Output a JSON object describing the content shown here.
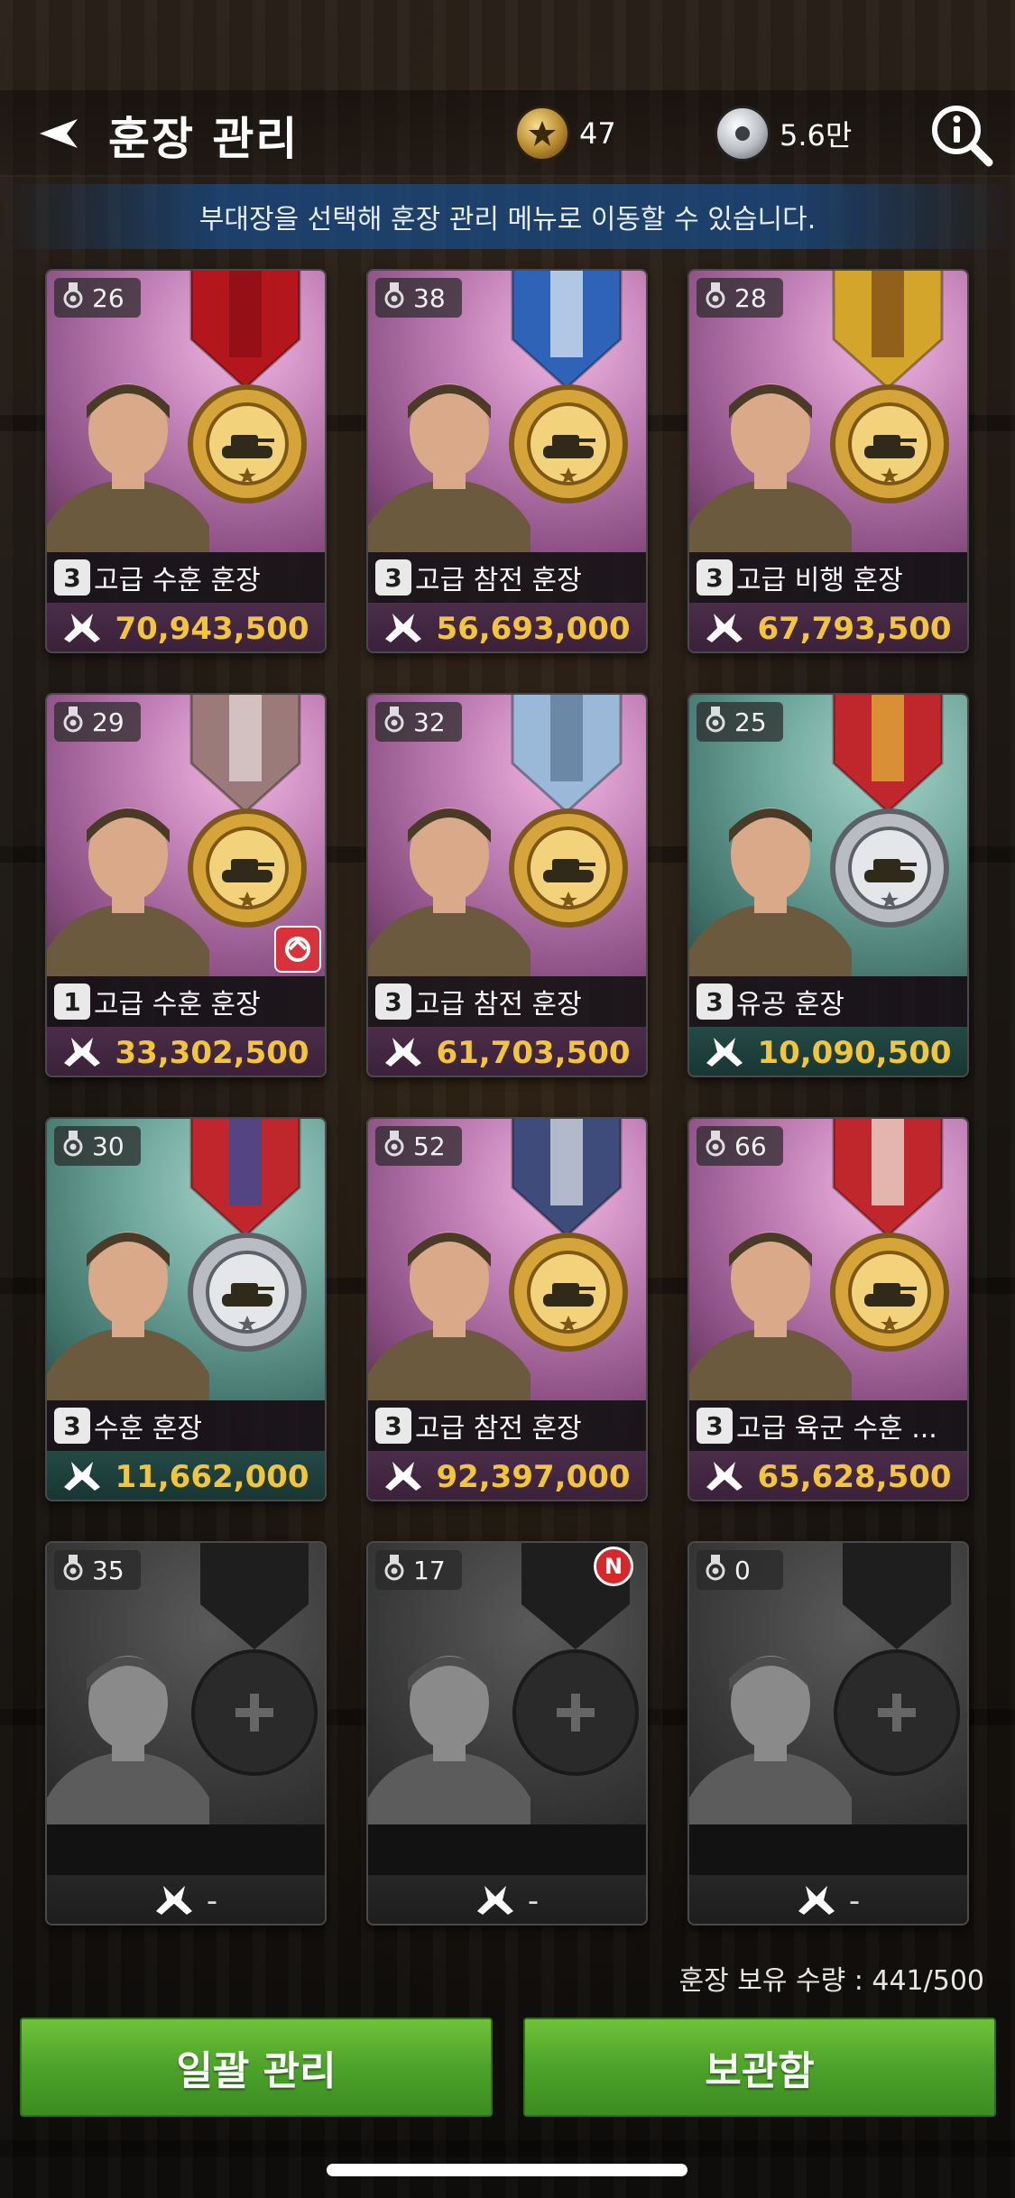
{
  "header": {
    "title": "훈장 관리",
    "gold_count": "47",
    "silver_count": "5.6만"
  },
  "hint": "부대장을 선택해 훈장 관리 메뉴로 이동할 수 있습니다.",
  "cards": [
    {
      "level": "26",
      "grade": "3",
      "name": "고급 수훈 훈장",
      "power": "70,943,500",
      "theme": "purple",
      "ribbon": "#b3161c",
      "ribbon2": "#8a0f14",
      "medal": "gold"
    },
    {
      "level": "38",
      "grade": "3",
      "name": "고급 참전 훈장",
      "power": "56,693,000",
      "theme": "purple",
      "ribbon": "#2f63b8",
      "ribbon2": "#dfe8f3",
      "medal": "gold"
    },
    {
      "level": "28",
      "grade": "3",
      "name": "고급 비행 훈장",
      "power": "67,793,500",
      "theme": "purple",
      "ribbon": "#d3a52a",
      "ribbon2": "#7b4a15",
      "medal": "gold"
    },
    {
      "level": "29",
      "grade": "1",
      "name": "고급 수훈 훈장",
      "power": "33,302,500",
      "theme": "purple",
      "ribbon": "#9b7a7a",
      "ribbon2": "#e6d8d8",
      "medal": "gold",
      "tag": true
    },
    {
      "level": "32",
      "grade": "3",
      "name": "고급 참전 훈장",
      "power": "61,703,500",
      "theme": "purple",
      "ribbon": "#9ab8d8",
      "ribbon2": "#5c7897",
      "medal": "gold"
    },
    {
      "level": "25",
      "grade": "3",
      "name": "유공 훈장",
      "power": "10,090,500",
      "theme": "teal",
      "ribbon": "#c0272d",
      "ribbon2": "#e2b33a",
      "medal": "silver"
    },
    {
      "level": "30",
      "grade": "3",
      "name": "수훈 훈장",
      "power": "11,662,000",
      "theme": "teal",
      "ribbon": "#c0272d",
      "ribbon2": "#2f4fa0",
      "medal": "silver"
    },
    {
      "level": "52",
      "grade": "3",
      "name": "고급 참전 훈장",
      "power": "92,397,000",
      "theme": "purple",
      "ribbon": "#3d4c7a",
      "ribbon2": "#d9dde6",
      "medal": "gold"
    },
    {
      "level": "66",
      "grade": "3",
      "name": "고급 육군 수훈 ...",
      "power": "65,628,500",
      "theme": "purple",
      "ribbon": "#c0272d",
      "ribbon2": "#efe6d8",
      "medal": "gold"
    },
    {
      "level": "35",
      "grade": "",
      "name": "",
      "power": "-",
      "theme": "empty"
    },
    {
      "level": "17",
      "grade": "",
      "name": "",
      "power": "-",
      "theme": "empty",
      "new": "N"
    },
    {
      "level": "0",
      "grade": "",
      "name": "",
      "power": "-",
      "theme": "empty"
    }
  ],
  "footer": {
    "count_text": "훈장 보유 수량 : 441/500",
    "bulk_button": "일괄 관리",
    "storage_button": "보관함"
  }
}
